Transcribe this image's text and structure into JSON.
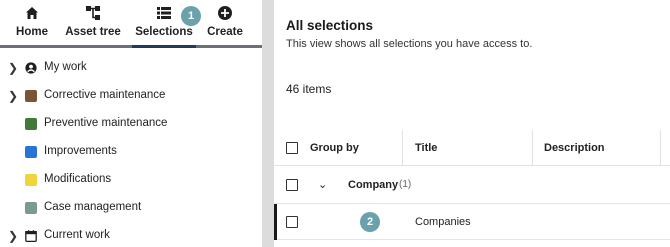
{
  "topnav": {
    "items": [
      {
        "label": "Home",
        "icon": "home-icon"
      },
      {
        "label": "Asset tree",
        "icon": "asset-tree-icon"
      },
      {
        "label": "Selections",
        "icon": "list-icon"
      },
      {
        "label": "Create",
        "icon": "plus-circle-icon"
      }
    ],
    "active": "Selections"
  },
  "badges": [
    "1",
    "2"
  ],
  "sidebar": {
    "items": [
      {
        "label": "My work",
        "icon": "user-circle-icon",
        "expandable": true
      },
      {
        "label": "Corrective maintenance",
        "color": "#7a5535",
        "expandable": true
      },
      {
        "label": "Preventive maintenance",
        "color": "#3f7a37",
        "expandable": false
      },
      {
        "label": "Improvements",
        "color": "#2a74d8",
        "expandable": false
      },
      {
        "label": "Modifications",
        "color": "#f0d53a",
        "expandable": false
      },
      {
        "label": "Case management",
        "color": "#7c9a8e",
        "expandable": false
      },
      {
        "label": "Current work",
        "icon": "calendar-icon",
        "expandable": true
      }
    ]
  },
  "main": {
    "title": "All selections",
    "subtitle": "This view shows all selections you have access to.",
    "count": "46 items",
    "columns": [
      "Group by",
      "Title",
      "Description"
    ],
    "group": {
      "label": "Company",
      "count": "(1)"
    },
    "rows": [
      {
        "title": "Companies"
      }
    ]
  }
}
